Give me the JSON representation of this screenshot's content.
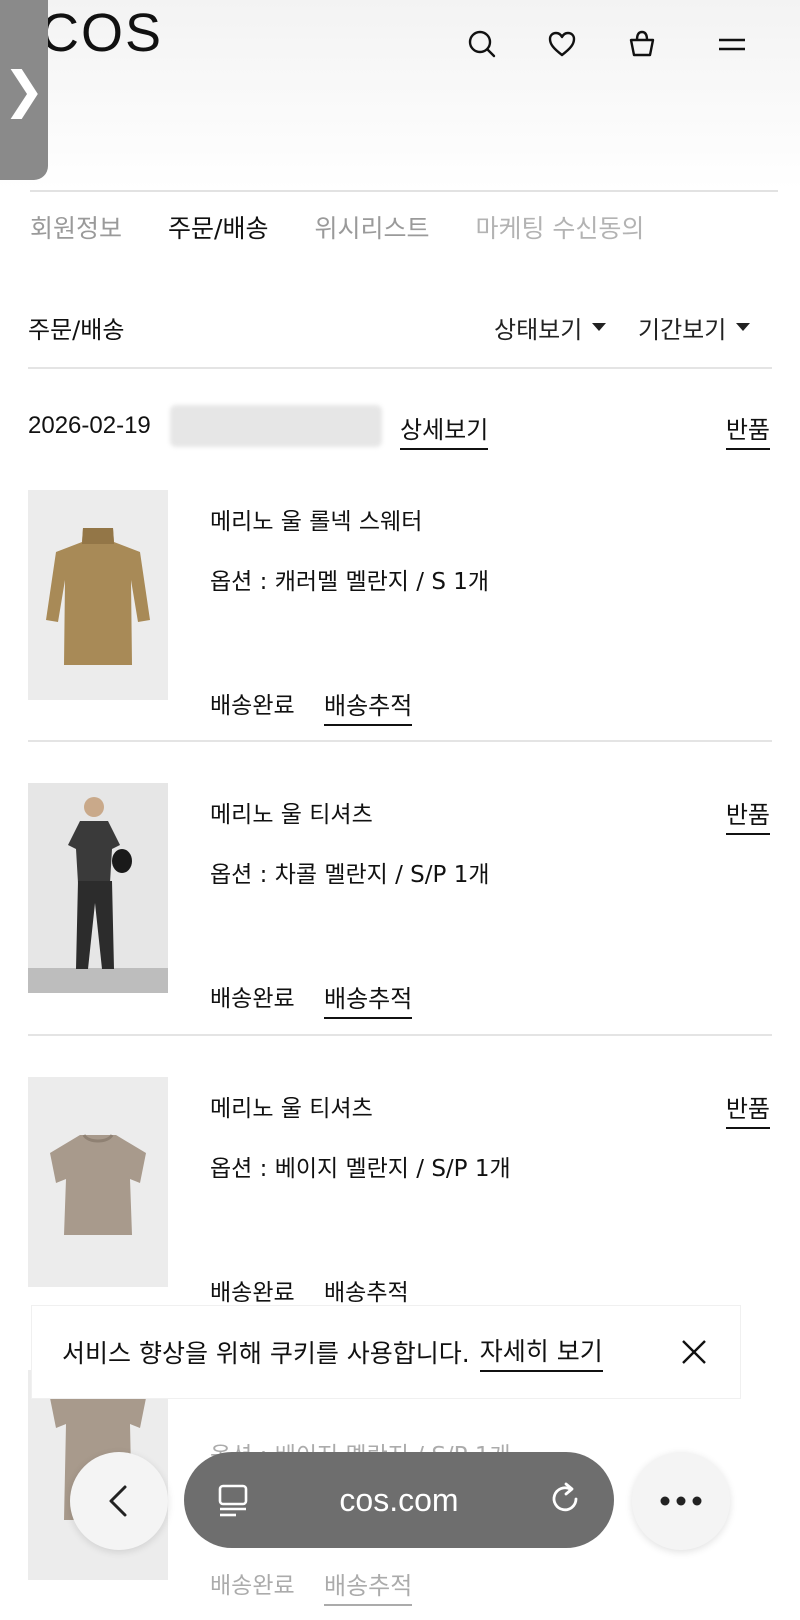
{
  "header": {
    "logo": "COS",
    "side_handle_glyph": "❯",
    "icons": [
      "search-icon",
      "heart-icon",
      "bag-icon",
      "menu-icon"
    ]
  },
  "tabs": [
    {
      "label": "회원정보",
      "active": false
    },
    {
      "label": "주문/배송",
      "active": true
    },
    {
      "label": "위시리스트",
      "active": false
    },
    {
      "label": "마케팅 수신동의",
      "active": false
    }
  ],
  "section": {
    "title": "주문/배송",
    "status_filter": "상태보기",
    "period_filter": "기간보기"
  },
  "order": {
    "date": "2026-02-19",
    "detail_link": "상세보기",
    "return_label": "반품"
  },
  "items": [
    {
      "name": "메리노 울 롤넥 스웨터",
      "option": "옵션 : 캐러멜 멜란지 / S 1개",
      "status": "배송완료",
      "track": "배송추적",
      "return": "",
      "image": "caramel-turtleneck-sweater"
    },
    {
      "name": "메리노 울 티셔츠",
      "option": "옵션 : 차콜 멜란지 / S/P 1개",
      "status": "배송완료",
      "track": "배송추적",
      "return": "반품",
      "image": "model-charcoal-tshirt"
    },
    {
      "name": "메리노 울 티셔츠",
      "option": "옵션 : 베이지 멜란지 / S/P 1개",
      "status": "배송완료",
      "track": "배송추적",
      "return": "반품",
      "image": "beige-tshirt"
    },
    {
      "name": "",
      "option": "옵션 : 베이지 멜란지 / S/P 1개",
      "status": "배송완료",
      "track": "배송추적",
      "return": "",
      "image": "beige-tshirt"
    }
  ],
  "cookie": {
    "text": "서비스 향상을 위해 쿠키를 사용합니다.",
    "link": "자세히 보기"
  },
  "browser": {
    "url": "cos.com"
  },
  "colors": {
    "caramel": "#a88a57",
    "charcoal": "#3a3a3a",
    "beige": "#a89a8c",
    "url_pill": "#6e6e6e"
  }
}
